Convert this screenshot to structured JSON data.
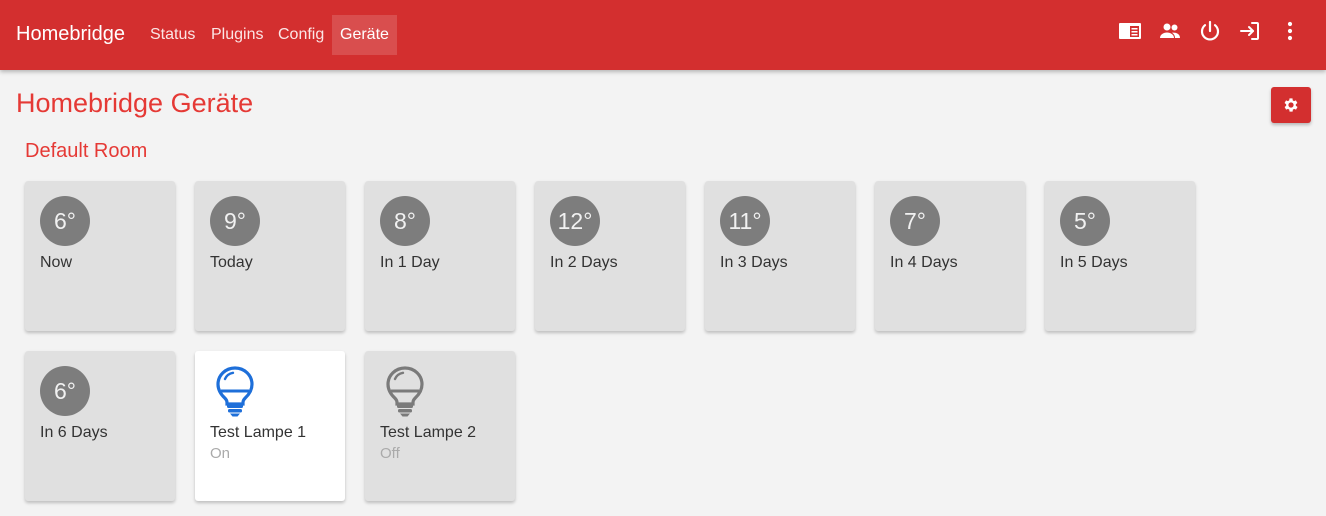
{
  "navbar": {
    "brand": "Homebridge",
    "items": [
      {
        "label": "Status"
      },
      {
        "label": "Plugins"
      },
      {
        "label": "Config"
      },
      {
        "label": "Geräte",
        "active": true
      }
    ],
    "icons": [
      "layout-icon",
      "users-icon",
      "power-icon",
      "logout-icon",
      "more-vert-icon"
    ],
    "accent_color": "#d32f2f"
  },
  "page": {
    "title": "Homebridge Geräte",
    "settings_icon": "gear-icon"
  },
  "room": {
    "title": "Default Room",
    "weather_tiles": [
      {
        "temp": "6°",
        "label": "Now"
      },
      {
        "temp": "9°",
        "label": "Today"
      },
      {
        "temp": "8°",
        "label": "In 1 Day"
      },
      {
        "temp": "12°",
        "label": "In 2 Days"
      },
      {
        "temp": "11°",
        "label": "In 3 Days"
      },
      {
        "temp": "7°",
        "label": "In 4 Days"
      },
      {
        "temp": "5°",
        "label": "In 5 Days"
      },
      {
        "temp": "6°",
        "label": "In 6 Days"
      }
    ],
    "lamps": [
      {
        "label": "Test Lampe 1",
        "state": "On",
        "icon": "lightbulb-icon",
        "color": "#1e6fd9"
      },
      {
        "label": "Test Lampe 2",
        "state": "Off",
        "icon": "lightbulb-icon",
        "color": "#7a7a7a"
      }
    ]
  }
}
